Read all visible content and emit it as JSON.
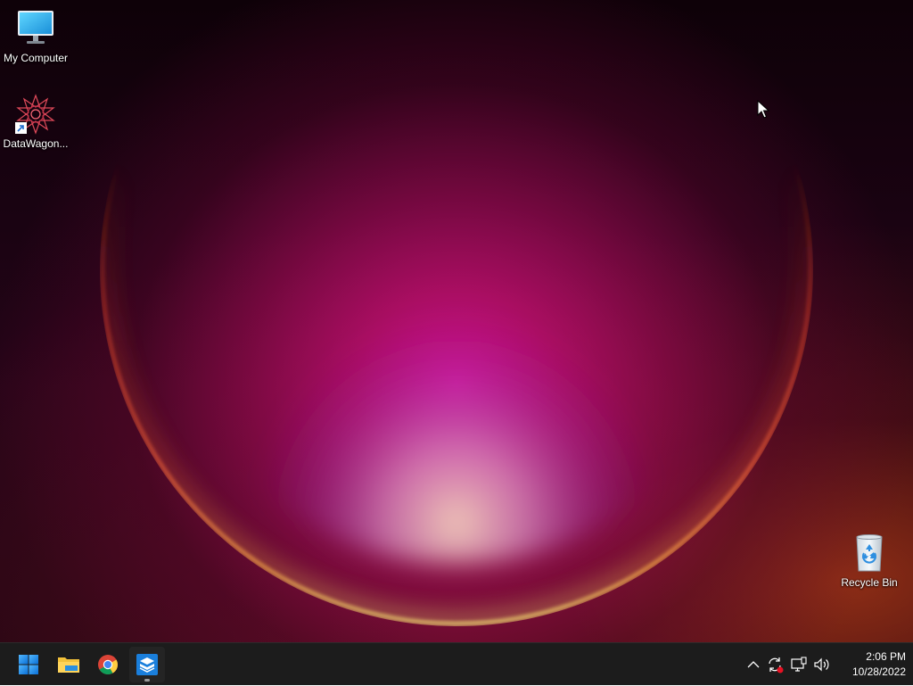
{
  "desktop": {
    "icons": [
      {
        "label": "My Computer",
        "icon": "monitor-icon"
      },
      {
        "label": "DataWagon...",
        "icon": "datawagon-app-icon",
        "shortcut": true
      },
      {
        "label": "Recycle Bin",
        "icon": "recycle-bin-icon"
      }
    ]
  },
  "taskbar": {
    "pinned": [
      {
        "name": "start",
        "icon": "windows-logo-icon"
      },
      {
        "name": "file-explorer",
        "icon": "folder-icon"
      },
      {
        "name": "chrome",
        "icon": "chrome-icon"
      },
      {
        "name": "datawagon",
        "icon": "datawagon-taskbar-icon",
        "running": true
      }
    ],
    "tray": {
      "icons": [
        "chevron-up-icon",
        "sync-icon",
        "network-icon",
        "volume-icon"
      ]
    },
    "clock": {
      "time": "2:06 PM",
      "date": "10/28/2022"
    }
  },
  "colors": {
    "taskbar": "#1c1c1c",
    "accent": "#0078d4"
  }
}
